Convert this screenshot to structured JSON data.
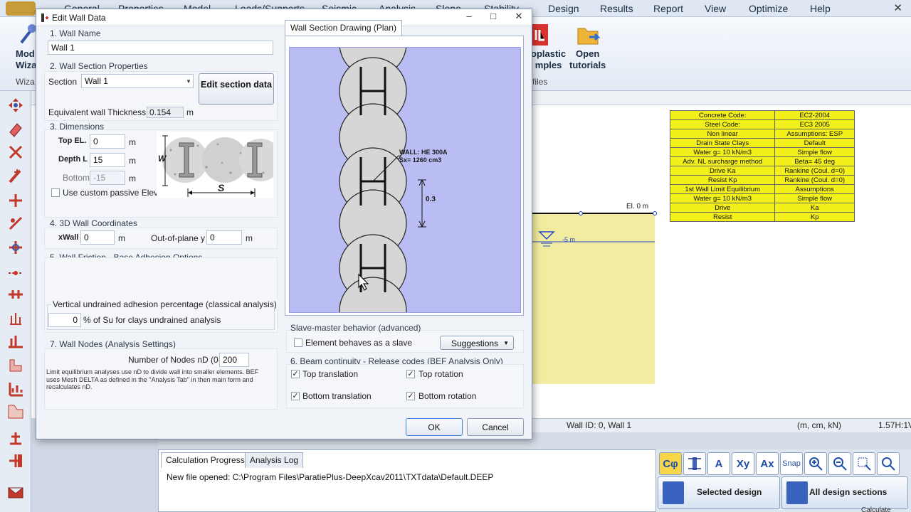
{
  "app": {
    "menu": [
      "General",
      "Properties",
      "Model",
      "Loads/Supports",
      "Seismic",
      "Analysis",
      "Slope",
      "Stability",
      "Design",
      "Results",
      "Report",
      "View",
      "Optimize",
      "Help"
    ],
    "ribbon": {
      "left_label_1": "Mod",
      "left_label_2": "Wiza",
      "left_group": "Wiza",
      "elastoplastic_1": "oplastic",
      "elastoplastic_2": "mples",
      "tutorials_1": "Open",
      "tutorials_2": "tutorials",
      "group_files": "files"
    },
    "props_table": [
      [
        "Concrete Code:",
        "EC2-2004"
      ],
      [
        "Steel Code:",
        "EC3 2005"
      ],
      [
        "Non linear",
        "Assumptions: ESP"
      ],
      [
        "Drain State Clays",
        "Default"
      ],
      [
        "Water g= 10 kN/m3",
        "Simple flow"
      ],
      [
        "Adv. NL surcharge method",
        "Beta= 45 deg"
      ],
      [
        "Drive Ka",
        "Rankine (Coul. d=0)"
      ],
      [
        "Resist Kp",
        "Rankine (Coul. d=0)"
      ],
      [
        "1st Wall Limit Equilibrium",
        "Assumptions"
      ],
      [
        "Water g= 10 kN/m3",
        "Simple flow"
      ],
      [
        "Drive",
        "Ka"
      ],
      [
        "Resist",
        "Kp"
      ]
    ],
    "canvas": {
      "el_label": "El. 0 m",
      "water_label": "-5 m"
    },
    "status": {
      "wall_id": "Wall ID: 0, Wall 1",
      "units": "(m, cm, kN)",
      "scale": "1.57H:1V"
    },
    "bottom_tabs": [
      "Calculation Progress",
      "Analysis Log"
    ],
    "log_line": "New file opened: C:\\Program Files\\ParatiePlus-DeepXcav2011\\TXTdata\\Default.DEEP",
    "tools": [
      "Cφ",
      "A",
      "Xy",
      "Ax",
      "Snap"
    ],
    "selected_design": "Selected design",
    "all_design_sections": "All design sections",
    "calc_label": "Calculate"
  },
  "dialog": {
    "title": "Edit Wall Data",
    "s1": "1. Wall Name",
    "wall_name": "Wall 1",
    "s2": "2. Wall Section Properties",
    "section_label": "Section",
    "section_value": "Wall 1",
    "edit_section": "Edit section data",
    "eq_thick_label": "Equivalent wall Thickness:",
    "eq_thick_value": "0.154",
    "eq_thick_unit": "m",
    "s3": "3. Dimensions",
    "top_el_label": "Top EL.",
    "top_el_value": "0",
    "depth_label": "Depth L",
    "depth_value": "15",
    "bottom_label": "Bottom",
    "bottom_value": "-15",
    "unit_m": "m",
    "custom_passive": "Use custom passive Elev.",
    "fig_w": "W",
    "fig_s": "S",
    "s4": "4. 3D Wall Coordinates",
    "xwall_label": "xWall",
    "xwall_value": "0",
    "out_of_plane_label": "Out-of-plane y",
    "out_of_plane_value": "0",
    "s5": "5. Wall Friction - Base Adhesion Options",
    "adhesion_group": "Vertical undrained adhesion percentage (classical analysis)",
    "adhesion_value": "0",
    "adhesion_text": "% of Su for clays undrained analysis",
    "s7": "7. Wall Nodes (Analysis Settings)",
    "nodes_label": "Number of Nodes nD (0-",
    "nodes_value": "200",
    "note": "Limit equilibrium analyses use nD to divide wall into smaller elements. BEF uses Mesh DELTA as defined in the \"Analysis Tab\" in then main form and recalculates nD.",
    "plan_tab": "Wall Section Drawing (Plan)",
    "plan_wall_label": "WALL: HE 300A",
    "plan_sx_label": "Sx= 1260 cm3",
    "plan_dim": "0.3",
    "slave_group": "Slave-master behavior (advanced)",
    "slave_check": "Element behaves as a slave",
    "suggestions": "Suggestions",
    "s6": "6. Beam continuity - Release codes (BEF Analysis Only)",
    "top_translation": "Top translation",
    "top_rotation": "Top rotation",
    "bottom_translation": "Bottom translation",
    "bottom_rotation": "Bottom rotation",
    "check_mark": "✓",
    "ok": "OK",
    "cancel": "Cancel"
  }
}
